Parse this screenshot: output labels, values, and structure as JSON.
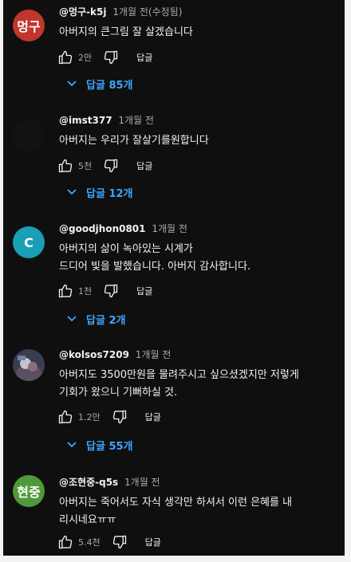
{
  "comments": [
    {
      "avatar_text": "멍구",
      "avatar_color": "#c1352d",
      "author": "@멍구-k5j",
      "time": "1개월 전(수정됨)",
      "lines": [
        "아버지의 큰그림 잘 살겠습니다"
      ],
      "likes": "2만",
      "reply_label": "답글",
      "replies_label": "답글 85개"
    },
    {
      "avatar_text": "",
      "avatar_color": "#121212",
      "author": "@imst377",
      "time": "1개월 전",
      "lines": [
        "아버지는 우리가 잘살기를원합니다"
      ],
      "likes": "5천",
      "reply_label": "답글",
      "replies_label": "답글 12개"
    },
    {
      "avatar_text": "C",
      "avatar_color": "#1a9fb6",
      "author": "@goodjhon0801",
      "time": "1개월 전",
      "lines": [
        "아버지의 삶이 녹아있는 시계가",
        "드디어 빛을 발했습니다. 아버지 감사합니다."
      ],
      "likes": "1천",
      "reply_label": "답글",
      "replies_label": "답글 2개"
    },
    {
      "avatar_text": "",
      "avatar_color": "#3a3c52",
      "author": "@kolsos7209",
      "time": "1개월 전",
      "lines": [
        "아버지도 3500만원을 물려주시고 싶으셨겠지만 저렇게",
        "기회가 왔으니 기뻐하실 것."
      ],
      "likes": "1.2만",
      "reply_label": "답글",
      "replies_label": "답글 55개"
    },
    {
      "avatar_text": "현중",
      "avatar_color": "#4e9a3a",
      "author": "@조현중-q5s",
      "time": "1개월 전",
      "lines": [
        "아버지는 죽어서도 자식 생각만 하셔서 이런 은혜를 내",
        "리시네요ㅠㅠ"
      ],
      "likes": "5.4천",
      "reply_label": "답글",
      "replies_label": ""
    }
  ],
  "icons": {
    "like": "thumbs-up-icon",
    "dislike": "thumbs-down-icon",
    "expand": "chevron-down-icon"
  }
}
